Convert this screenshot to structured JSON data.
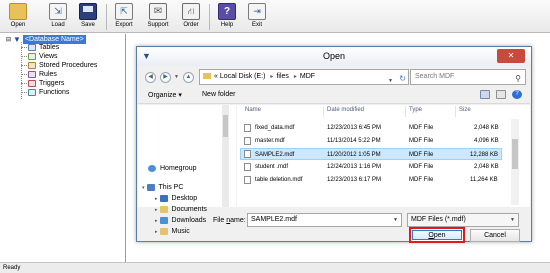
{
  "toolbar": {
    "buttons": [
      {
        "label": "Open",
        "icon": "open-folder-icon"
      },
      {
        "label": "Load",
        "icon": "load-icon"
      },
      {
        "label": "Save",
        "icon": "save-disk-icon"
      },
      {
        "label": "Export",
        "icon": "export-icon"
      },
      {
        "label": "Support",
        "icon": "mail-icon"
      },
      {
        "label": "Order",
        "icon": "shopping-basket-icon"
      },
      {
        "label": "Help",
        "icon": "help-icon"
      },
      {
        "label": "Exit",
        "icon": "exit-icon"
      }
    ]
  },
  "tree": {
    "root": "<Database Name>",
    "items": [
      "Tables",
      "Views",
      "Stored Procedures",
      "Rules",
      "Triggers",
      "Functions"
    ]
  },
  "status": {
    "text": "Ready"
  },
  "dialog": {
    "title": "Open",
    "close": "✕",
    "breadcrumb": {
      "prefix": "«",
      "drive": "Local Disk (E:)",
      "folder1": "files",
      "folder2": "MDF"
    },
    "search_placeholder": "Search MDF",
    "organize": "Organize ▾",
    "new_folder": "New folder",
    "nav": {
      "homegroup": "Homegroup",
      "this_pc": "This PC",
      "desktop": "Desktop",
      "documents": "Documents",
      "downloads": "Downloads",
      "music": "Music"
    },
    "columns": {
      "name": "Name",
      "date": "Date modified",
      "type": "Type",
      "size": "Size"
    },
    "files": [
      {
        "name": "fixed_data.mdf",
        "date": "12/23/2013 6:45 PM",
        "type": "MDF File",
        "size": "2,048 KB"
      },
      {
        "name": "master.mdf",
        "date": "11/13/2014 5:22 PM",
        "type": "MDF File",
        "size": "4,096 KB"
      },
      {
        "name": "SAMPLE2.mdf",
        "date": "11/20/2012 1:05 PM",
        "type": "MDF File",
        "size": "12,288 KB"
      },
      {
        "name": "student .mdf",
        "date": "12/24/2013 1:16 PM",
        "type": "MDF File",
        "size": "2,048 KB"
      },
      {
        "name": "table deletion.mdf",
        "date": "12/23/2013 6:17 PM",
        "type": "MDF File",
        "size": "11,264 KB"
      }
    ],
    "filename_label_pre": "File ",
    "filename_label_ul": "n",
    "filename_label_post": "ame:",
    "filename_value": "SAMPLE2.mdf",
    "filetype": "MDF Files (*.mdf)",
    "open_ul": "O",
    "open_rest": "pen",
    "cancel": "Cancel"
  },
  "colors": {
    "selection": "#3a7ad6",
    "row_highlight": "#cce8ff",
    "open_border": "#e11b1b"
  }
}
